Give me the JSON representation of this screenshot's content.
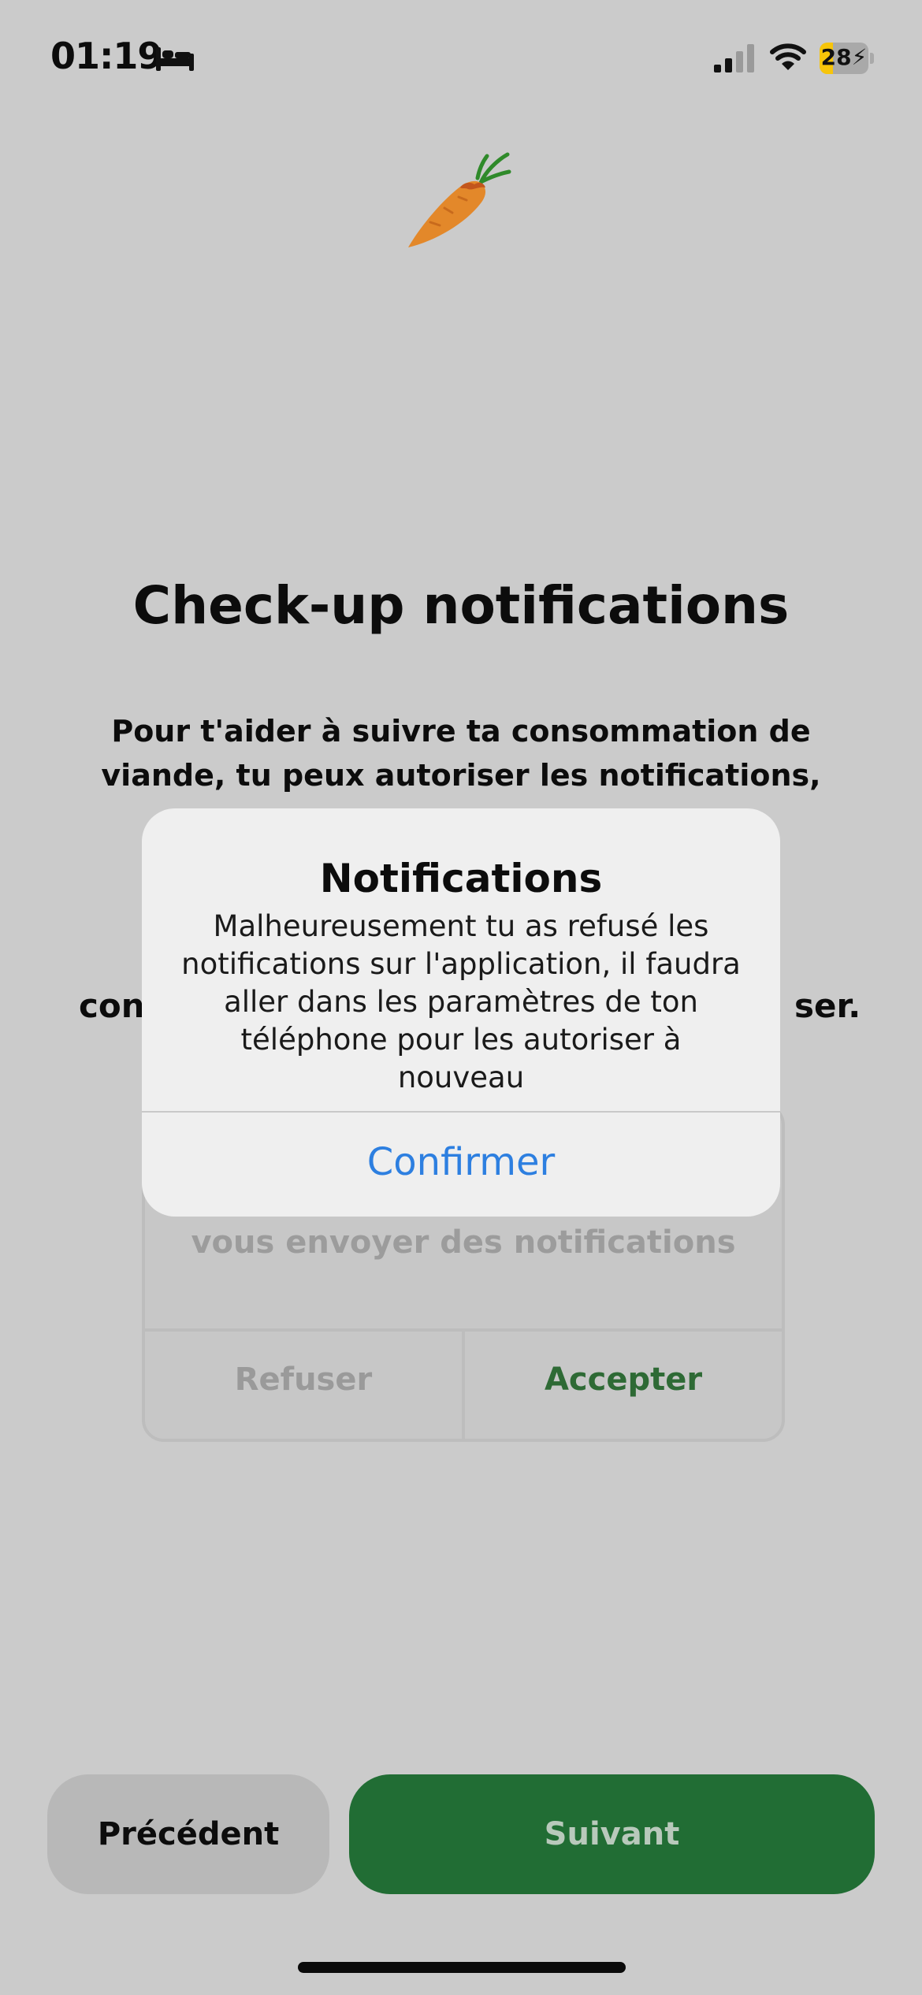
{
  "status_bar": {
    "time": "01:19",
    "focus_icon": "bed-icon",
    "signal_icon": "cellular-signal-icon",
    "wifi_icon": "wifi-icon",
    "battery_level": "28",
    "battery_charging": true,
    "battery_color": "#f7c50a"
  },
  "logo_icon": "carrot-icon",
  "page": {
    "title": "Check-up notifications",
    "intro_line_1": "Pour t'aider à suivre ta consommation de",
    "intro_line_2": "viande, tu peux autoriser les notifications,",
    "partial_left": "con",
    "partial_right": "ser."
  },
  "system_prompt_behind": {
    "message_visible": "vous envoyer des notifications",
    "refuse_label": "Refuser",
    "accept_label": "Accepter"
  },
  "alert": {
    "title": "Notifications",
    "message": "Malheureusement tu as refusé les notifications sur l'application, il faudra aller dans les paramètres de ton téléphone pour les autoriser à nouveau",
    "confirm_label": "Confirmer",
    "confirm_color": "#2d7fe0"
  },
  "footer": {
    "previous_label": "Précédent",
    "next_label": "Suivant",
    "next_color": "#216d34"
  }
}
